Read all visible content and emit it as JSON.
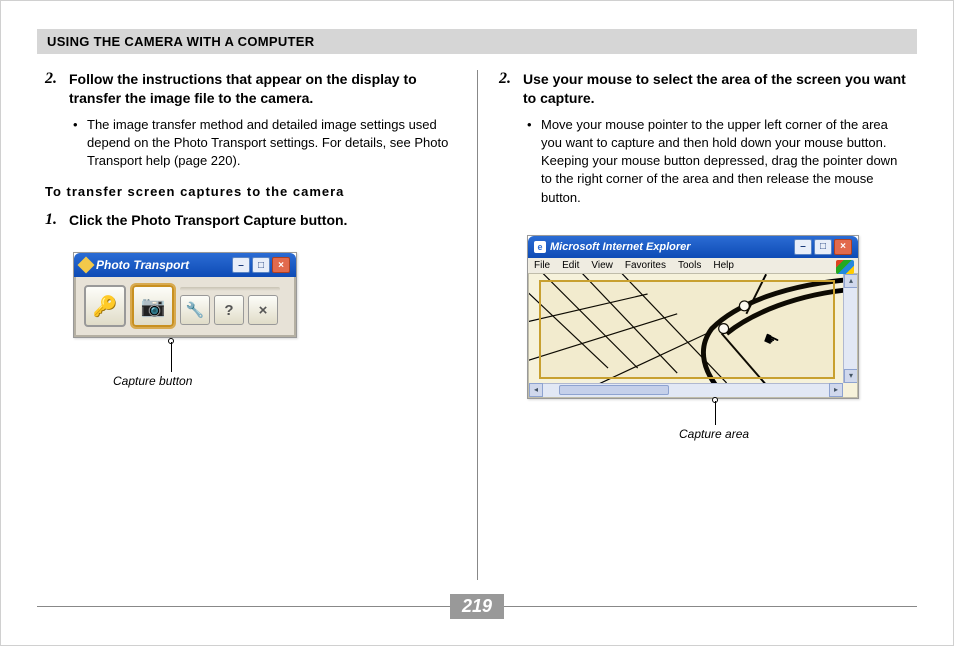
{
  "header": {
    "title": "USING THE CAMERA WITH A COMPUTER"
  },
  "left": {
    "step2": {
      "num": "2.",
      "text": "Follow the instructions that appear on the display to transfer the image file to the camera.",
      "bullet": "The image transfer method and detailed image settings used depend on the Photo Transport settings. For details, see Photo Transport help (page 220)."
    },
    "subhead": "To transfer screen captures to the camera",
    "step1": {
      "num": "1.",
      "text": "Click the Photo Transport Capture button."
    },
    "pt_window": {
      "title": "Photo Transport",
      "buttons": {
        "min": "–",
        "max": "□",
        "close": "×",
        "tool1": "🔑",
        "tool2": "📷",
        "wrench": "🔧",
        "help": "?",
        "x": "×"
      }
    },
    "caption": "Capture button"
  },
  "right": {
    "step2": {
      "num": "2.",
      "text": "Use your mouse to select the area of the screen you want to capture.",
      "bullet": "Move your mouse pointer to the upper left corner of the area you want to capture and then hold down your mouse button. Keeping your mouse button depressed, drag the pointer down to the right corner of the area and then release the mouse button."
    },
    "ie_window": {
      "title": "Microsoft Internet Explorer",
      "menu": [
        "File",
        "Edit",
        "View",
        "Favorites",
        "Tools",
        "Help"
      ],
      "buttons": {
        "min": "–",
        "max": "□",
        "close": "×"
      }
    },
    "caption": "Capture area"
  },
  "page_number": "219"
}
